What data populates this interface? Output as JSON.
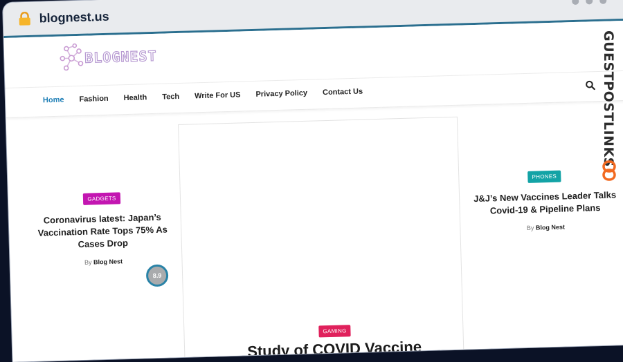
{
  "browser": {
    "url": "blognest.us"
  },
  "site": {
    "logo_text": "BLOGNEST"
  },
  "nav": {
    "items": [
      {
        "label": "Home",
        "active": true
      },
      {
        "label": "Fashion"
      },
      {
        "label": "Health"
      },
      {
        "label": "Tech"
      },
      {
        "label": "Write For US"
      },
      {
        "label": "Privacy Policy"
      },
      {
        "label": "Contact Us"
      }
    ]
  },
  "posts": {
    "left": {
      "category": "GADGETS",
      "title": "Coronavirus latest: Japan’s Vaccination Rate Tops 75% As Cases Drop",
      "by": "By",
      "author": "Blog Nest",
      "rating": "8.9"
    },
    "featured": {
      "category": "GAMING",
      "title": "Study of COVID Vaccine"
    },
    "right": {
      "category": "PHONES",
      "title": "J&J’s New Vaccines Leader Talks Covid-19 & Pipeline Plans",
      "by": "By",
      "author": "Blog Nest"
    }
  },
  "brand": {
    "label": "GUESTPOSTLINKS"
  },
  "colors": {
    "accent": "#1f7fb6",
    "gadgets": "#c316b1",
    "phones": "#13a3a6",
    "gaming": "#e0215c",
    "brand_orange": "#f26a21"
  },
  "icons": {
    "lock": "lock-icon",
    "search": "search-icon",
    "link": "link-icon"
  }
}
